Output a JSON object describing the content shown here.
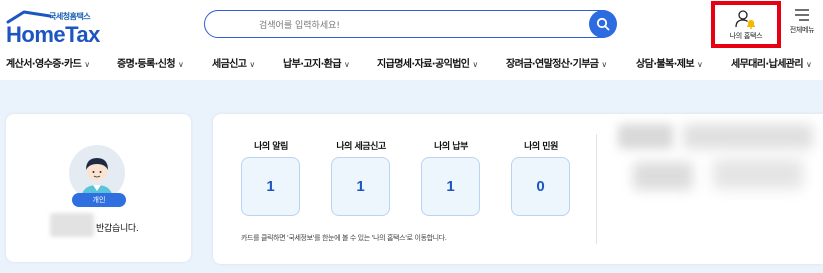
{
  "header": {
    "logo_sub": "국세청홈택스",
    "logo_main": "HomeTax",
    "search_placeholder": "검색어를 입력하세요!",
    "my_hometax_label": "나의 홈택스",
    "all_menu_label": "전체메뉴"
  },
  "nav": {
    "items": [
      {
        "label": "계산서·영수증·카드"
      },
      {
        "label": "증명·등록·신청"
      },
      {
        "label": "세금신고"
      },
      {
        "label": "납부·고지·환급"
      },
      {
        "label": "지급명세·자료·공익법인"
      },
      {
        "label": "장려금·연말정산·기부금"
      },
      {
        "label": "상담·불복·제보"
      },
      {
        "label": "세무대리·납세관리"
      }
    ]
  },
  "profile": {
    "badge": "개인",
    "welcome": "반갑습니다."
  },
  "summary": {
    "tiles": [
      {
        "title": "나의 알림",
        "value": "1"
      },
      {
        "title": "나의 세금신고",
        "value": "1"
      },
      {
        "title": "나의 납부",
        "value": "1"
      },
      {
        "title": "나의 민원",
        "value": "0"
      }
    ],
    "notice": "카드를 클릭하면 '국세정보'를 한눈에 볼 수 있는 '나의 홈택스'로 이동합니다."
  },
  "colors": {
    "brand": "#1d56c0",
    "accent": "#2d6be0",
    "highlight": "#e60012",
    "background": "#eaf2fb"
  }
}
